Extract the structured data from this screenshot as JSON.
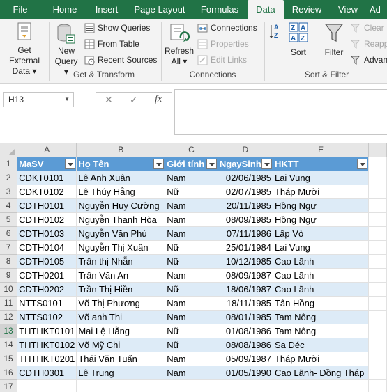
{
  "tabs": [
    "File",
    "Home",
    "Insert",
    "Page Layout",
    "Formulas",
    "Data",
    "Review",
    "View",
    "Ad"
  ],
  "active_tab": "Data",
  "ribbon": {
    "get_external_data": {
      "line1": "Get External",
      "line2": "Data ▾"
    },
    "new_query": {
      "line1": "New",
      "line2": "Query ▾"
    },
    "show_queries": "Show Queries",
    "from_table": "From Table",
    "recent_sources": "Recent Sources",
    "group_get_transform": "Get & Transform",
    "refresh_all": {
      "line1": "Refresh",
      "line2": "All ▾"
    },
    "connections": "Connections",
    "properties": "Properties",
    "edit_links": "Edit Links",
    "group_connections": "Connections",
    "sort_az": "A↓Z",
    "sort_label": "Sort",
    "filter_label": "Filter",
    "clear": "Clear",
    "reapply": "Reapp",
    "advanced": "Advan",
    "group_sort_filter": "Sort & Filter"
  },
  "formula_bar": {
    "name_box": "H13",
    "cancel": "✕",
    "enter": "✓",
    "fx": "fx",
    "content": ""
  },
  "columns": [
    "A",
    "B",
    "C",
    "D",
    "E"
  ],
  "row_numbers": [
    "1",
    "2",
    "3",
    "4",
    "5",
    "6",
    "7",
    "8",
    "9",
    "10",
    "11",
    "12",
    "13",
    "14",
    "15",
    "16",
    "17"
  ],
  "selected_row": "13",
  "table": {
    "headers": [
      "MaSV",
      "Họ Tên",
      "Giới tính",
      "NgaySinh",
      "HKTT"
    ],
    "rows": [
      [
        "CDKT0101",
        "Lê Anh Xuân",
        "Nam",
        "02/06/1985",
        "Lai Vung"
      ],
      [
        "CDKT0102",
        "Lê Thúy Hằng",
        "Nữ",
        "02/07/1985",
        "Tháp Mười"
      ],
      [
        "CDTH0101",
        "Nguyễn Huy Cường",
        "Nam",
        "20/11/1985",
        "Hồng Ngự"
      ],
      [
        "CDTH0102",
        "Nguyễn Thanh Hòa",
        "Nam",
        "08/09/1985",
        "Hồng Ngự"
      ],
      [
        "CDTH0103",
        "Nguyễn Văn Phú",
        "Nam",
        "07/11/1986",
        "Lấp Vò"
      ],
      [
        "CDTH0104",
        "Nguyễn Thị Xuân",
        "Nữ",
        "25/01/1984",
        "Lai Vung"
      ],
      [
        "CDTH0105",
        "Trần thị Nhẫn",
        "Nữ",
        "10/12/1985",
        "Cao Lãnh"
      ],
      [
        "CDTH0201",
        "Trần Văn An",
        "Nam",
        "08/09/1987",
        "Cao Lãnh"
      ],
      [
        "CDTH0202",
        "Trần Thị Hiền",
        "Nữ",
        "18/06/1987",
        "Cao Lãnh"
      ],
      [
        "NTTS0101",
        "Võ Thị Phương",
        "Nam",
        "18/11/1985",
        "Tân  Hồng"
      ],
      [
        "NTTS0102",
        "Võ anh Thi",
        "Nam",
        "08/01/1985",
        "Tam Nông"
      ],
      [
        "THTHKT0101",
        "Mai Lệ Hằng",
        "Nữ",
        "01/08/1986",
        "Tam Nông"
      ],
      [
        "THTHKT0102",
        "Võ Mỹ Chi",
        "Nữ",
        "08/08/1986",
        "Sa Déc"
      ],
      [
        "THTHKT0201",
        "Thái Văn Tuấn",
        "Nam",
        "05/09/1987",
        "Tháp Mười"
      ],
      [
        "CDTH0301",
        "Lê Trung",
        "Nam",
        "01/05/1990",
        "Cao Lãnh- Đồng Tháp"
      ]
    ]
  },
  "colors": {
    "excel_green": "#217346",
    "table_header": "#5b9bd5",
    "band": "#ddebf7"
  }
}
